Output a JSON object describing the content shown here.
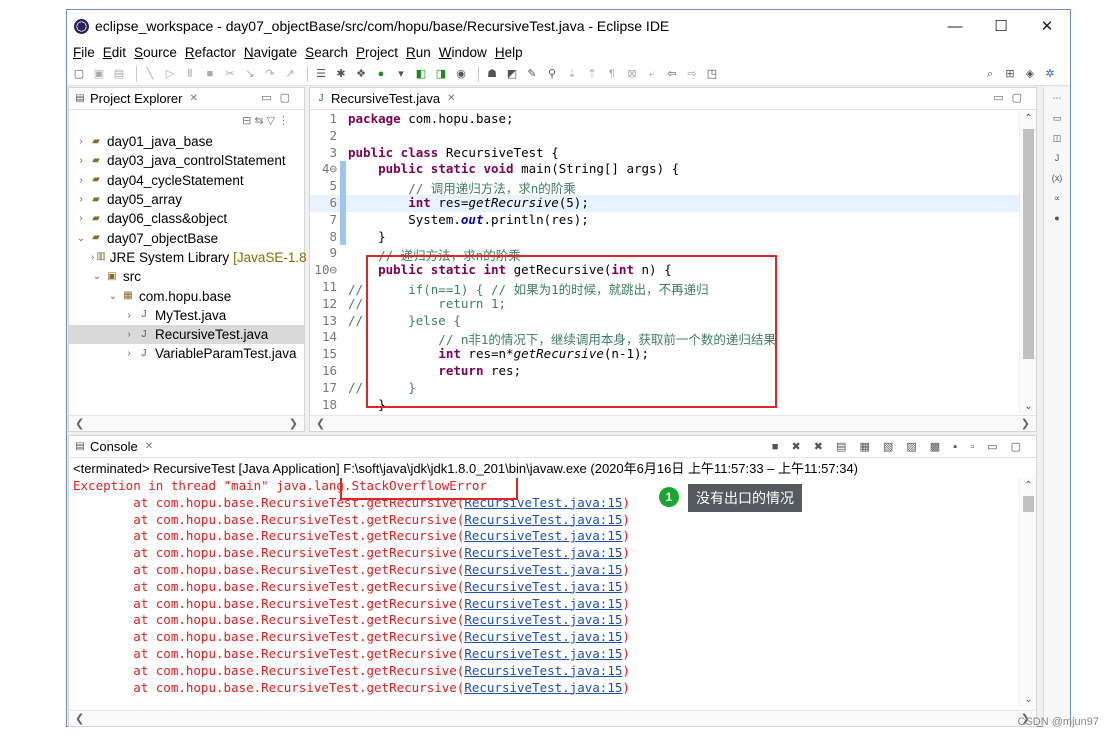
{
  "window": {
    "title": "eclipse_workspace - day07_objectBase/src/com/hopu/base/RecursiveTest.java - Eclipse IDE",
    "minimize": "—",
    "maximize": "☐",
    "close": "✕"
  },
  "menu": [
    "File",
    "Edit",
    "Source",
    "Refactor",
    "Navigate",
    "Search",
    "Project",
    "Run",
    "Window",
    "Help"
  ],
  "explorer": {
    "tab_label": "Project Explorer",
    "tree": [
      {
        "label": "day01_java_base",
        "arrow": "›"
      },
      {
        "label": "day03_java_controlStatement",
        "arrow": "›"
      },
      {
        "label": "day04_cycleStatement",
        "arrow": "›"
      },
      {
        "label": "day05_array",
        "arrow": "›"
      },
      {
        "label": "day06_class&object",
        "arrow": "›"
      },
      {
        "label": "day07_objectBase",
        "arrow": "⌄"
      },
      {
        "label": "JRE System Library",
        "suffix": "[JavaSE-1.8",
        "arrow": "›"
      },
      {
        "label": "src",
        "arrow": "⌄"
      },
      {
        "label": "com.hopu.base",
        "arrow": "⌄"
      },
      {
        "label": "MyTest.java",
        "arrow": "›"
      },
      {
        "label": "RecursiveTest.java",
        "arrow": "›"
      },
      {
        "label": "VariableParamTest.java",
        "arrow": "›"
      }
    ]
  },
  "editor": {
    "tab_label": "RecursiveTest.java",
    "lines": [
      {
        "n": "1",
        "t": "package com.hopu.base;"
      },
      {
        "n": "2",
        "t": ""
      },
      {
        "n": "3",
        "t": "public class RecursiveTest {"
      },
      {
        "n": "4⊖",
        "t": "    public static void main(String[] args) {"
      },
      {
        "n": "5",
        "t": "        // 调用递归方法，求n的阶乘"
      },
      {
        "n": "6",
        "t": "        int res=getRecursive(5);"
      },
      {
        "n": "7",
        "t": "        System.out.println(res);"
      },
      {
        "n": "8",
        "t": "    }"
      },
      {
        "n": "9",
        "t": "    // 递归方法，求n的阶乘"
      },
      {
        "n": "10⊖",
        "t": "    public static int getRecursive(int n) {"
      },
      {
        "n": "11",
        "t": "//      if(n==1) { // 如果为1的时候，就跳出，不再递归"
      },
      {
        "n": "12",
        "t": "//          return 1;"
      },
      {
        "n": "13",
        "t": "//      }else {"
      },
      {
        "n": "14",
        "t": "            // n非1的情况下，继续调用本身，获取前一个数的递归结果"
      },
      {
        "n": "15",
        "t": "            int res=n*getRecursive(n-1);"
      },
      {
        "n": "16",
        "t": "            return res;"
      },
      {
        "n": "17",
        "t": "//      }"
      },
      {
        "n": "18",
        "t": "    }"
      }
    ]
  },
  "console": {
    "tab_label": "Console",
    "status": "<terminated> RecursiveTest [Java Application] F:\\soft\\java\\jdk\\jdk1.8.0_201\\bin\\javaw.exe  (2020年6月16日 上午11:57:33 – 上午11:57:34)",
    "exception": "Exception in thread \"main\" java.lang.StackOverflowError",
    "trace_prefix": "        at com.hopu.base.RecursiveTest.getRecursive(",
    "trace_link": "RecursiveTest.java:15",
    "trace_suffix": ")",
    "trace_count": 12
  },
  "callout": {
    "badge": "1",
    "label": "没有出口的情况"
  },
  "watermark": "CSDN @mjun97",
  "colors": {
    "highlight_box": "#e02525",
    "keyword": "#7f0055",
    "comment": "#3f7f5f",
    "error": "#e02020"
  }
}
